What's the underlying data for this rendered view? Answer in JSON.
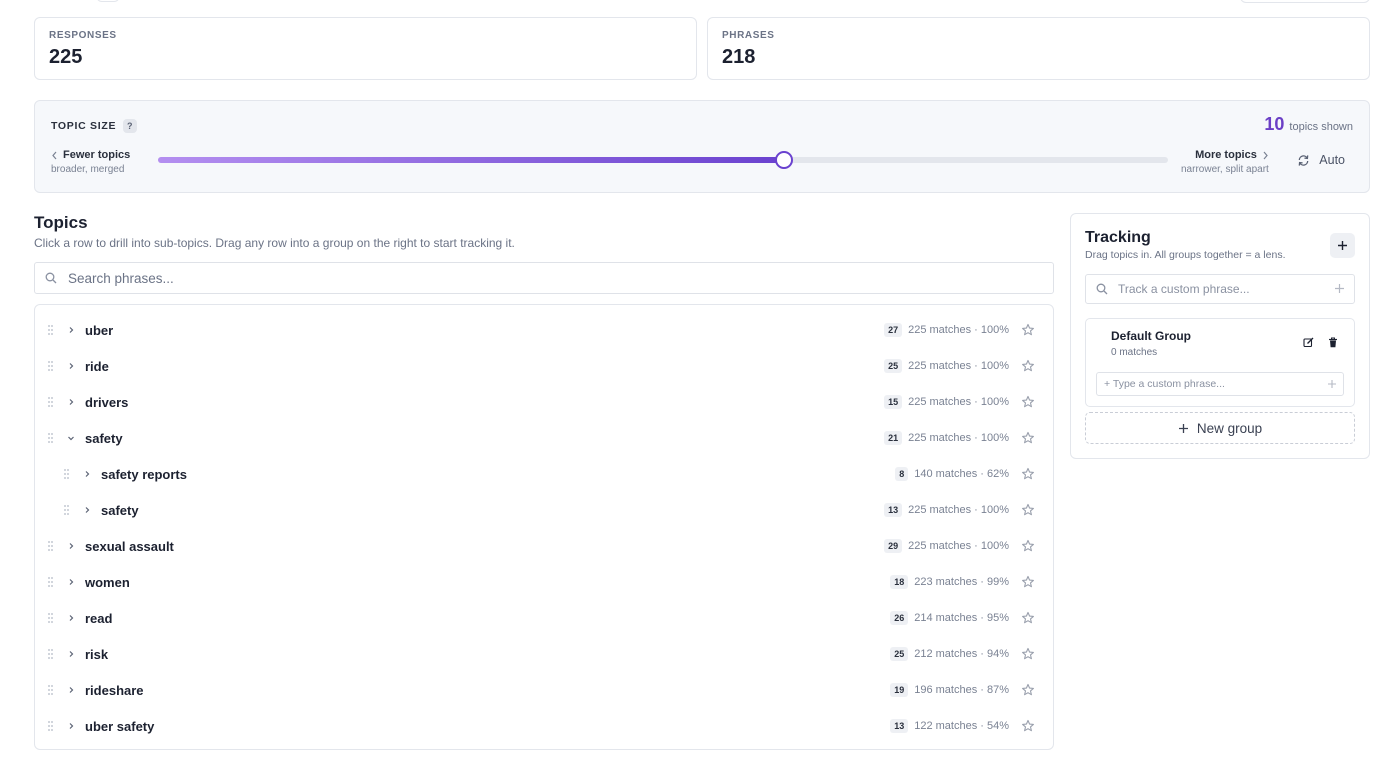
{
  "stats": {
    "responses": {
      "label": "RESPONSES",
      "value": "225"
    },
    "phrases": {
      "label": "PHRASES",
      "value": "218"
    }
  },
  "topic_size": {
    "title": "TOPIC SIZE",
    "help": "?",
    "shown_count": "10",
    "shown_label": "topics shown",
    "fewer_label": "Fewer topics",
    "fewer_sub": "broader, merged",
    "more_label": "More topics",
    "more_sub": "narrower, split apart",
    "auto_label": "Auto",
    "slider_level": 0.62,
    "colors": {
      "accent": "#6a42cf",
      "accent_light": "#b48ff0"
    }
  },
  "topics": {
    "title": "Topics",
    "description": "Click a row to drill into sub-topics. Drag any row into a group on the right to start tracking it.",
    "search_placeholder": "Search phrases...",
    "rows": [
      {
        "label": "uber",
        "count": "27",
        "matches": "225 matches · 100%",
        "level": 0,
        "expanded": false
      },
      {
        "label": "ride",
        "count": "25",
        "matches": "225 matches · 100%",
        "level": 0,
        "expanded": false
      },
      {
        "label": "drivers",
        "count": "15",
        "matches": "225 matches · 100%",
        "level": 0,
        "expanded": false
      },
      {
        "label": "safety",
        "count": "21",
        "matches": "225 matches · 100%",
        "level": 0,
        "expanded": true
      },
      {
        "label": "safety reports",
        "count": "8",
        "matches": "140 matches · 62%",
        "level": 1,
        "expanded": false
      },
      {
        "label": "safety",
        "count": "13",
        "matches": "225 matches · 100%",
        "level": 1,
        "expanded": false
      },
      {
        "label": "sexual assault",
        "count": "29",
        "matches": "225 matches · 100%",
        "level": 0,
        "expanded": false
      },
      {
        "label": "women",
        "count": "18",
        "matches": "223 matches · 99%",
        "level": 0,
        "expanded": false
      },
      {
        "label": "read",
        "count": "26",
        "matches": "214 matches · 95%",
        "level": 0,
        "expanded": false
      },
      {
        "label": "risk",
        "count": "25",
        "matches": "212 matches · 94%",
        "level": 0,
        "expanded": false
      },
      {
        "label": "rideshare",
        "count": "19",
        "matches": "196 matches · 87%",
        "level": 0,
        "expanded": false
      },
      {
        "label": "uber safety",
        "count": "13",
        "matches": "122 matches · 54%",
        "level": 0,
        "expanded": false
      }
    ]
  },
  "tracking": {
    "title": "Tracking",
    "description": "Drag topics in. All groups together = a lens.",
    "custom_placeholder": "Track a custom phrase...",
    "group": {
      "name": "Default Group",
      "matches": "0 matches",
      "input_placeholder": "+ Type a custom phrase..."
    },
    "new_group_label": "New group"
  }
}
